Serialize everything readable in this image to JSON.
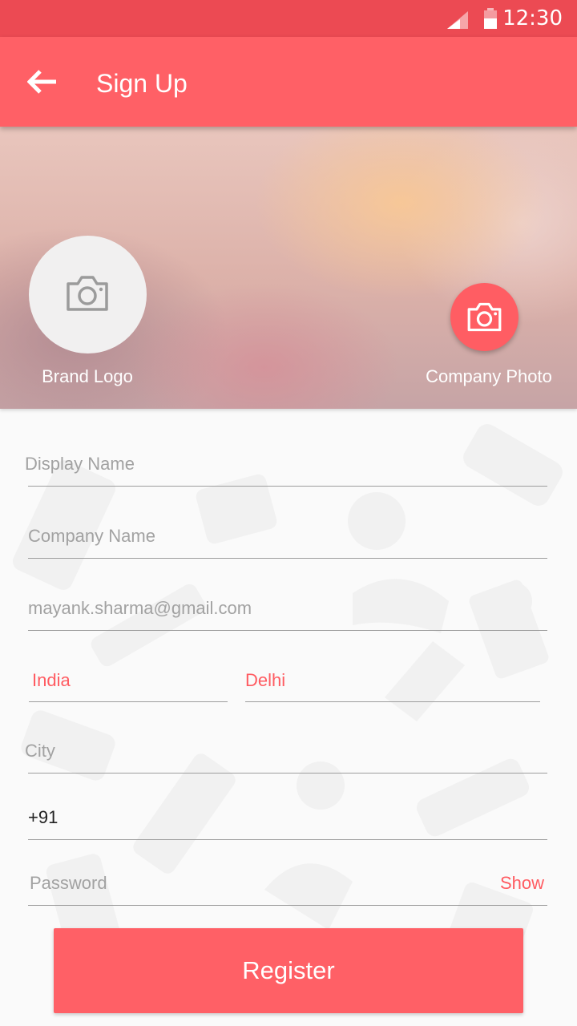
{
  "status_bar": {
    "time": "12:30"
  },
  "app_bar": {
    "title": "Sign Up"
  },
  "hero": {
    "brand_logo_label": "Brand Logo",
    "company_photo_label": "Company Photo"
  },
  "form": {
    "display_name_placeholder": "Display Name",
    "company_name_placeholder": "Company Name",
    "email_placeholder": "mayank.sharma@gmail.com",
    "country_value": "India",
    "state_value": "Delhi",
    "city_placeholder": "City",
    "phone_value": "+91",
    "password_placeholder": "Password",
    "show_label": "Show",
    "register_label": "Register"
  },
  "colors": {
    "accent": "#ff6066",
    "status_bar": "#ec4a53",
    "accent_text": "#ff5b61"
  }
}
